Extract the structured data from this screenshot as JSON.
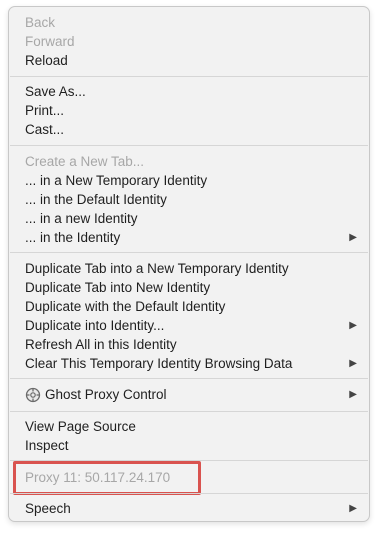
{
  "menu": {
    "nav": [
      {
        "label": "Back",
        "disabled": true
      },
      {
        "label": "Forward",
        "disabled": true
      },
      {
        "label": "Reload",
        "disabled": false
      }
    ],
    "page": [
      {
        "label": "Save As..."
      },
      {
        "label": "Print..."
      },
      {
        "label": "Cast..."
      }
    ],
    "new_tab": {
      "header": "Create a New Tab...",
      "items": [
        {
          "label": "... in a New Temporary Identity"
        },
        {
          "label": "... in the Default Identity"
        },
        {
          "label": "... in a new Identity"
        },
        {
          "label": "... in the Identity",
          "submenu": true
        }
      ]
    },
    "duplicate": [
      {
        "label": "Duplicate Tab into a New Temporary Identity"
      },
      {
        "label": "Duplicate Tab into New Identity"
      },
      {
        "label": "Duplicate with the Default Identity"
      },
      {
        "label": "Duplicate into Identity...",
        "submenu": true
      },
      {
        "label": "Refresh All in this Identity"
      },
      {
        "label": "Clear This Temporary Identity Browsing Data",
        "submenu": true
      }
    ],
    "ghost_proxy": {
      "label": "Ghost Proxy Control",
      "icon": "ghost-proxy-icon",
      "submenu": true
    },
    "dev": [
      {
        "label": "View Page Source"
      },
      {
        "label": "Inspect"
      }
    ],
    "proxy_info": {
      "label": "Proxy 11: 50.117.24.170",
      "disabled": true
    },
    "speech": {
      "label": "Speech",
      "submenu": true
    },
    "submenu_arrow": "▶"
  },
  "colors": {
    "menu_bg": "#f2f2f2",
    "disabled_text": "#a7a7a7",
    "highlight_border": "#d9534f"
  }
}
